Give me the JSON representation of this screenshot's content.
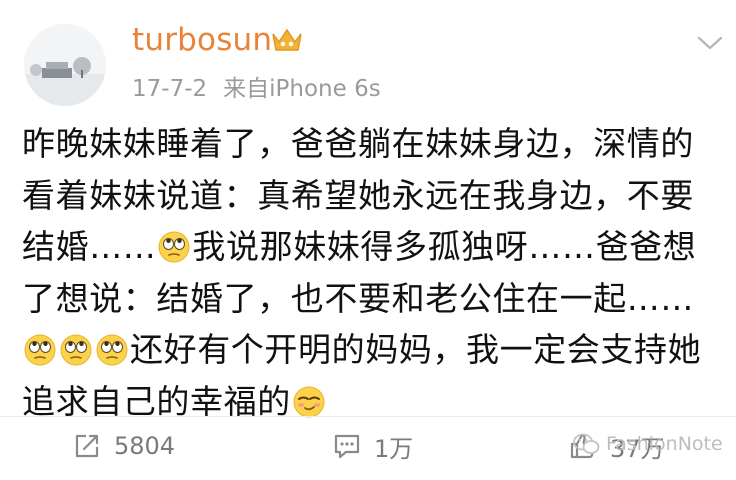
{
  "post": {
    "username": "turbosun",
    "date": "17-7-2",
    "source": "来自iPhone 6s",
    "segments": [
      "昨晚妹妹睡着了，爸爸躺在妹妹身边，深情的看着妹妹说道：真希望她永远在我身边，不要结婚……",
      "我说那妹妹得多孤独呀……爸爸想了想说：结婚了，也不要和老公住在一起……",
      "还好有个开明的妈妈，我一定会支持她追求自己的幸福的"
    ],
    "emoji_names": [
      "rolling-eyes-emoji",
      "rolling-eyes-emoji",
      "rolling-eyes-emoji",
      "smirk-emoji"
    ]
  },
  "actions": {
    "repost_count": "5804",
    "comment_count": "1万",
    "like_count": "37万"
  },
  "watermark": "FashionNote",
  "colors": {
    "username": "#e8833a",
    "meta": "#9a9a9a",
    "body_text": "#111111",
    "action_text": "#7a7a7a"
  }
}
